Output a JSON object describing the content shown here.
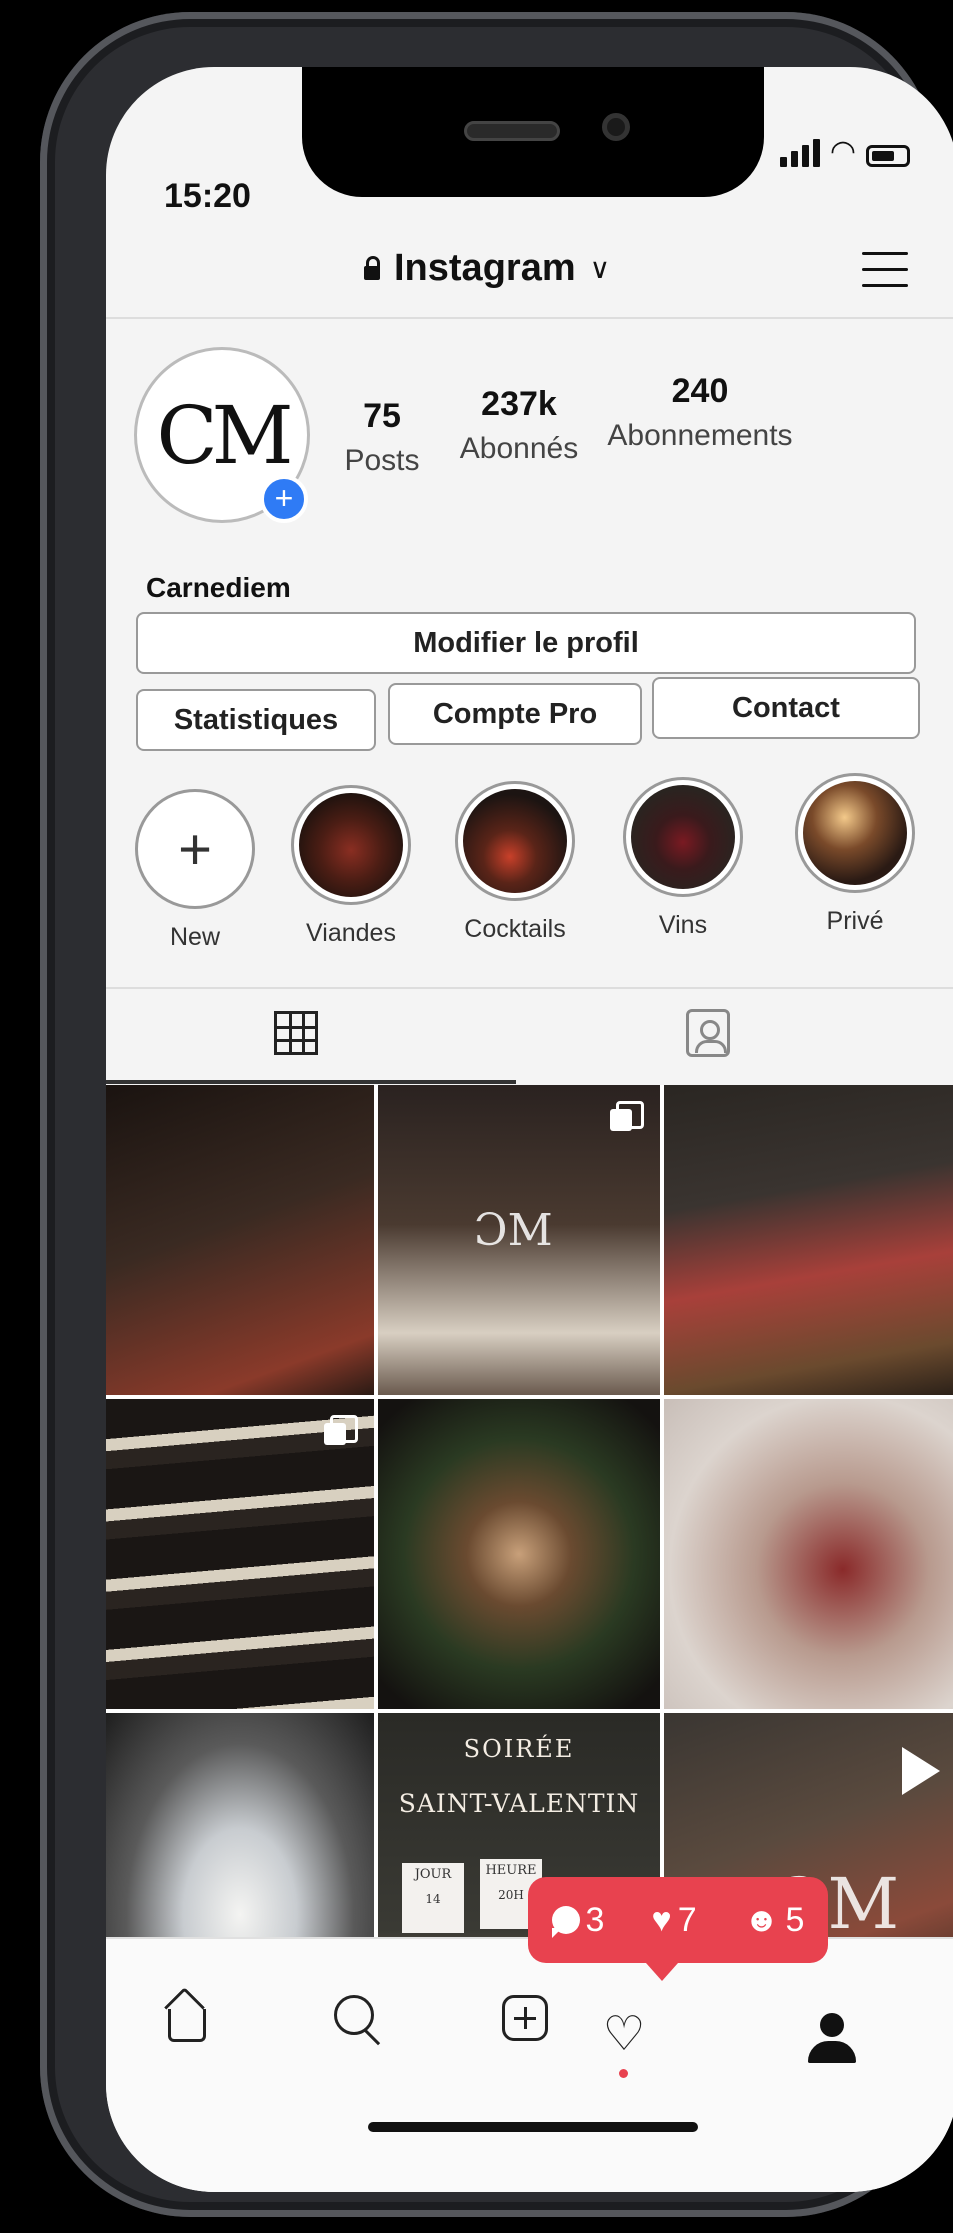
{
  "status": {
    "time": "15:20"
  },
  "header": {
    "account": "Instagram"
  },
  "profile": {
    "avatar_text": "CM",
    "username": "Carnediem",
    "stats": [
      {
        "value": "75",
        "label": "Posts"
      },
      {
        "value": "237k",
        "label": "Abonnés"
      },
      {
        "value": "240",
        "label": "Abonnements"
      }
    ]
  },
  "buttons": {
    "edit": "Modifier le profil",
    "stats": "Statistiques",
    "pro": "Compte Pro",
    "contact": "Contact"
  },
  "highlights": [
    {
      "label": "New"
    },
    {
      "label": "Viandes"
    },
    {
      "label": "Cocktails"
    },
    {
      "label": "Vins"
    },
    {
      "label": "Privé"
    }
  ],
  "posts": {
    "soiree_line1": "SOIRÉE",
    "soiree_line2": "SAINT-VALENTIN",
    "jour_label": "JOUR",
    "jour_value": "14",
    "heure_label": "HEURE",
    "heure_value": "20H"
  },
  "notifications": {
    "comments": "3",
    "likes": "7",
    "followers": "5"
  },
  "colors": {
    "accent": "#e8424f",
    "badge": "#2f7bf5"
  }
}
